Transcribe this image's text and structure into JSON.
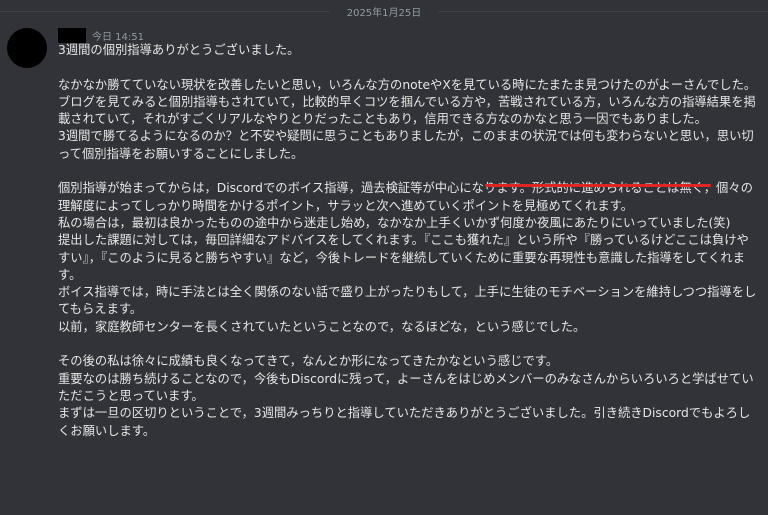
{
  "divider": {
    "date": "2025年1月25日"
  },
  "message": {
    "timestamp": "今日 14:51",
    "paragraphs": [
      [
        "3週間の個別指導ありがとうございました。"
      ],
      [
        "なかなか勝てていない現状を改善したいと思い，いろんな方のnoteやXを見ている時にたまたま見つけたのがよーさんでした。",
        "ブログを見てみると個別指導もされていて，比較的早くコツを掴んでいる方や，苦戦されている方，いろんな方の指導結果を掲載されていて，それがすごくリアルなやりとりだったこともあり，信用できる方なのかなと思う一因でもありました。",
        "3週間で勝てるようになるのか？と不安や疑問に思うこともありましたが，このままの状況では何も変わらないと思い，思い切って個別指導をお願いすることにしました。"
      ],
      [
        "個別指導が始まってからは，Discordでのボイス指導，過去検証等が中心になります。形式的に進められることは無く，個々の理解度によってしっかり時間をかけるポイント，サラッと次へ進めていくポイントを見極めてくれます。",
        "私の場合は，最初は良かったものの途中から迷走し始め，なかなか上手くいかず何度か夜風にあたりにいっていました(笑)",
        "提出した課題に対しては，毎回詳細なアドバイスをしてくれます。『ここも獲れた』という所や『勝っているけどここは負けやすい』，『このように見ると勝ちやすい』など，今後トレードを継続していくために重要な再現性も意識した指導をしてくれます。",
        "ボイス指導では，時に手法とは全く関係のない話で盛り上がったりもして，上手に生徒のモチベーションを維持しつつ指導をしてもらえます。",
        "以前，家庭教師センターを長くされていたということなので，なるほどな，という感じでした。"
      ],
      [
        "その後の私は徐々に成績も良くなってきて，なんとか形になってきたかなという感じです。",
        "重要なのは勝ち続けることなので，今後もDiscordに残って，よーさんをはじめメンバーのみなさんからいろいろと学ばせていただこうと思っています。",
        "まずは一旦の区切りということで，3週間みっちりと指導していただきありがとうございました。引き続きDiscordでもよろしくお願いします。"
      ]
    ]
  },
  "colors": {
    "background": "#313338",
    "text": "#e6e6e6",
    "muted": "#949ba4",
    "underline": "#e02424"
  }
}
